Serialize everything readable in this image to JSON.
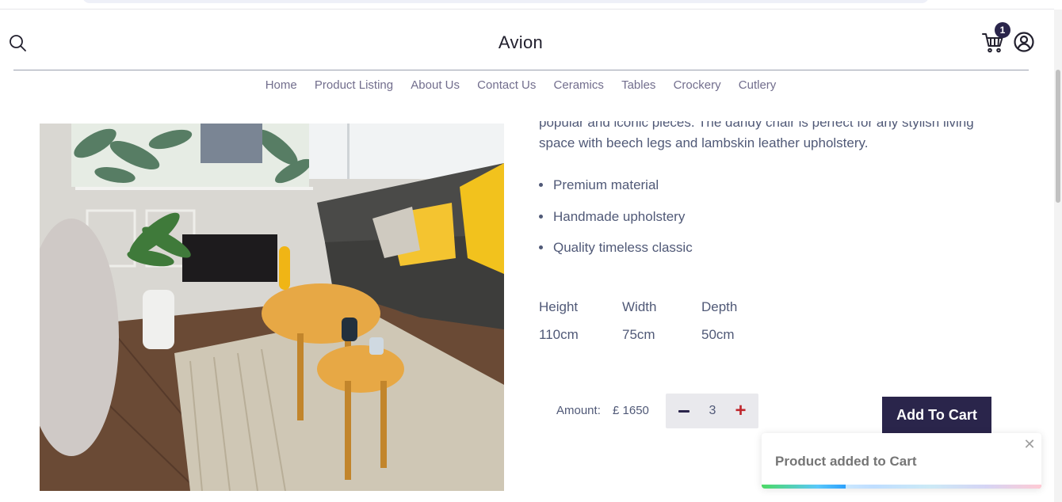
{
  "header": {
    "brand": "Avion",
    "cart_count": "1"
  },
  "nav": {
    "items": [
      {
        "label": "Home"
      },
      {
        "label": "Product Listing"
      },
      {
        "label": "About Us"
      },
      {
        "label": "Contact Us"
      },
      {
        "label": "Ceramics"
      },
      {
        "label": "Tables"
      },
      {
        "label": "Crockery"
      },
      {
        "label": "Cutlery"
      }
    ]
  },
  "product": {
    "description_line1": "popular and iconic pieces. The dandy chair is perfect for any stylish living",
    "description_line2": "space with beech legs and lambskin leather upholstery.",
    "features": [
      "Premium material",
      "Handmade upholstery",
      "Quality timeless classic"
    ],
    "dimensions": {
      "height_label": "Height",
      "height_value": "110cm",
      "width_label": "Width",
      "width_value": "75cm",
      "depth_label": "Depth",
      "depth_value": "50cm"
    },
    "amount_label": "Amount:",
    "amount_value": "£ 1650",
    "quantity": "3",
    "add_to_cart_label": "Add To Cart"
  },
  "toast": {
    "message": "Product added to Cart",
    "close_glyph": "✕",
    "progress": 0.3
  },
  "icons": {
    "search": "search-icon",
    "cart": "cart-icon",
    "user": "user-icon",
    "minus": "minus-icon",
    "plus": "plus-icon"
  },
  "colors": {
    "brand_dark": "#2a254b",
    "text_muted": "#505977",
    "nav_text": "#726e8d",
    "plus_red": "#c0272d"
  }
}
